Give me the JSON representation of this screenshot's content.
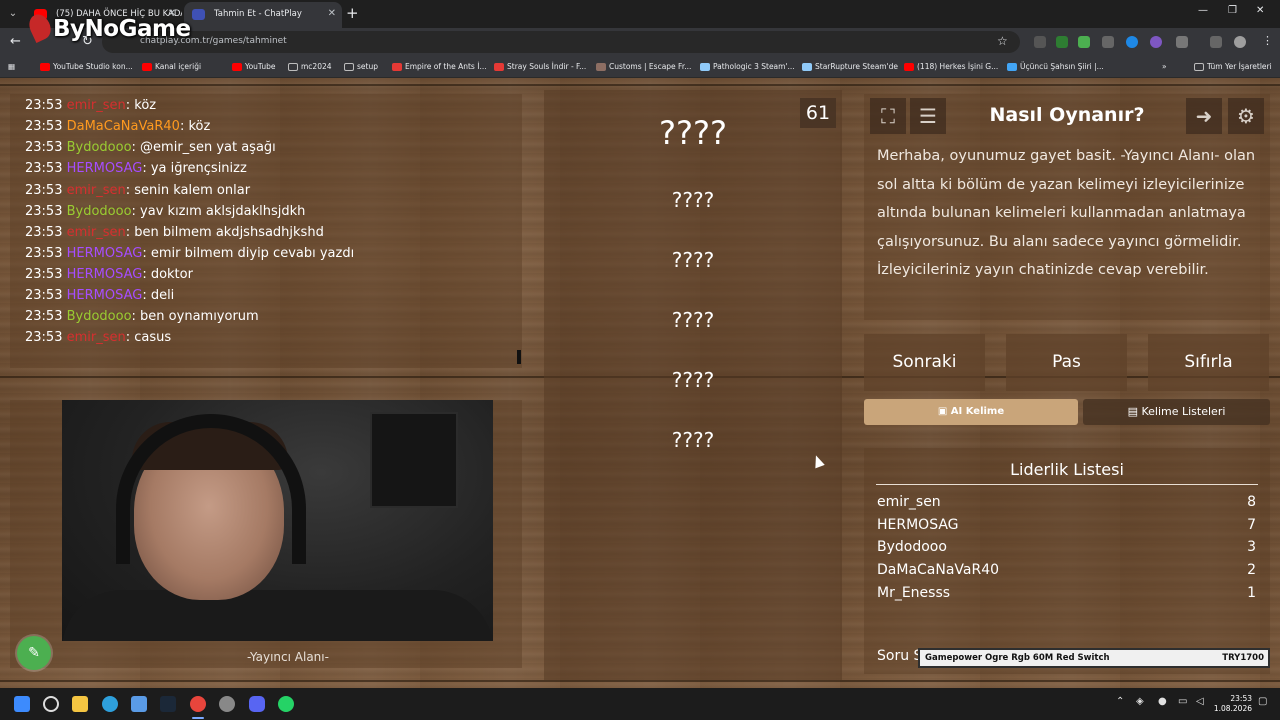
{
  "browser": {
    "tabs": [
      {
        "title": "(75) DAHA ÖNCE HİÇ BU KADA",
        "active": false
      },
      {
        "title": "Tahmin Et - ChatPlay",
        "active": true
      }
    ],
    "new_tab": "+",
    "url": "chatplay.com.tr/games/tahminet",
    "window_controls": [
      "—",
      "❐",
      "✕"
    ],
    "bookmarks": [
      {
        "label": "YouTube Studio kon...",
        "icon": "youtube-icon",
        "color": "#ff0000"
      },
      {
        "label": "Kanal içeriği",
        "icon": "youtube-icon",
        "color": "#ff0000"
      },
      {
        "label": "YouTube",
        "icon": "youtube-icon",
        "color": "#ff0000"
      },
      {
        "label": "mc2024",
        "icon": "folder-icon",
        "color": "#bdbdbd"
      },
      {
        "label": "setup",
        "icon": "folder-icon",
        "color": "#bdbdbd"
      },
      {
        "label": "Empire of the Ants İ...",
        "icon": "site-icon",
        "color": "#e53935"
      },
      {
        "label": "Stray Souls İndir - F...",
        "icon": "site-icon",
        "color": "#e53935"
      },
      {
        "label": "Customs | Escape Fr...",
        "icon": "site-icon",
        "color": "#8d6e63"
      },
      {
        "label": "Pathologic 3 Steam'...",
        "icon": "steam-icon",
        "color": "#90caf9"
      },
      {
        "label": "StarRupture Steam'de",
        "icon": "steam-icon",
        "color": "#90caf9"
      },
      {
        "label": "(118) Herkes İşini G...",
        "icon": "youtube-icon",
        "color": "#ff0000"
      },
      {
        "label": "Üçüncü Şahsın Şiiri |...",
        "icon": "site-icon",
        "color": "#42a5f5"
      }
    ],
    "all_bookmarks": "Tüm Yer İşaretleri",
    "overlay_logo": "ByNoGame"
  },
  "chat": {
    "messages": [
      {
        "time": "23:53",
        "user": "emir_sen",
        "color": "#d62f2f",
        "text": ": köz"
      },
      {
        "time": "23:53",
        "user": "DaMaCaNaVaR40",
        "color": "#ff9a1f",
        "text": ": köz"
      },
      {
        "time": "23:53",
        "user": "Bydodooo",
        "color": "#9acd32",
        "text": ": @emir_sen yat aşağı"
      },
      {
        "time": "23:53",
        "user": "HERMOSAG",
        "color": "#a64dff",
        "text": ": ya iğrençsinizz"
      },
      {
        "time": "23:53",
        "user": "emir_sen",
        "color": "#d62f2f",
        "text": ": senin kalem onlar"
      },
      {
        "time": "23:53",
        "user": "Bydodooo",
        "color": "#9acd32",
        "text": ": yav kızım aklsjdaklhsjdkh"
      },
      {
        "time": "23:53",
        "user": "emir_sen",
        "color": "#d62f2f",
        "text": ": ben bilmem akdjshsadhjkshd"
      },
      {
        "time": "23:53",
        "user": "HERMOSAG",
        "color": "#a64dff",
        "text": ": emir bilmem diyip cevabı yazdı"
      },
      {
        "time": "23:53",
        "user": "HERMOSAG",
        "color": "#a64dff",
        "text": ": doktor"
      },
      {
        "time": "23:53",
        "user": "HERMOSAG",
        "color": "#a64dff",
        "text": ": deli"
      },
      {
        "time": "23:53",
        "user": "Bydodooo",
        "color": "#9acd32",
        "text": ": ben oynamıyorum"
      },
      {
        "time": "23:53",
        "user": "emir_sen",
        "color": "#d62f2f",
        "text": ": casus"
      }
    ]
  },
  "stream": {
    "label": "-Yayıncı Alanı-"
  },
  "game": {
    "timer": "61",
    "words": [
      "????",
      "????",
      "????",
      "????",
      "????",
      "????"
    ]
  },
  "help": {
    "title": "Nasıl Oynanır?",
    "text": "Merhaba, oyunumuz gayet basit. -Yayıncı Alanı- olan sol altta ki bölüm de yazan kelimeyi izleyicilerinize altında bulunan kelimeleri kullanmadan anlatmaya çalışıyorsunuz. Bu alanı sadece yayıncı görmelidir. İzleyicileriniz yayın chatinizde cevap verebilir."
  },
  "actions": {
    "next": "Sonraki",
    "pass": "Pas",
    "reset": "Sıfırla",
    "ai_word": "AI Kelime",
    "word_lists": "Kelime Listeleri"
  },
  "leaderboard": {
    "title": "Liderlik Listesi",
    "rows": [
      {
        "name": "emir_sen",
        "score": "8"
      },
      {
        "name": "HERMOSAG",
        "score": "7"
      },
      {
        "name": "Bydodooo",
        "score": "3"
      },
      {
        "name": "DaMaCaNaVaR40",
        "score": "2"
      },
      {
        "name": "Mr_Enesss",
        "score": "1"
      }
    ],
    "question_label": "Soru S"
  },
  "ad": {
    "text": "Gamepower Ogre Rgb 60M Red Switch",
    "price": "TRY1700"
  },
  "taskbar": {
    "time": "23:53",
    "date": "1.08.2026"
  }
}
